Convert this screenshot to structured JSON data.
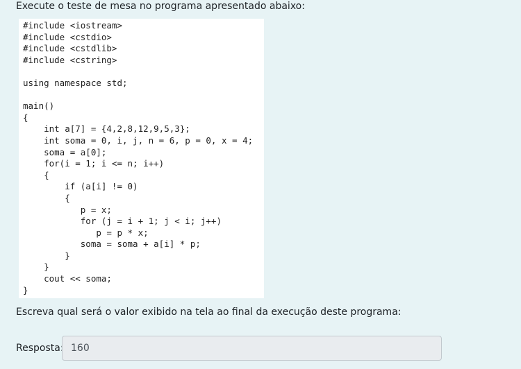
{
  "question": {
    "prompt": "Execute o teste de mesa no programa apresentado abaixo:",
    "code": "#include <iostream>\n#include <cstdio>\n#include <cstdlib>\n#include <cstring>\n\nusing namespace std;\n\nmain()\n{\n    int a[7] = {4,2,8,12,9,5,3};\n    int soma = 0, i, j, n = 6, p = 0, x = 4;\n    soma = a[0];\n    for(i = 1; i <= n; i++)\n    {\n        if (a[i] != 0)\n        {\n           p = x;\n           for (j = i + 1; j < i; j++)\n              p = p * x;\n           soma = soma + a[i] * p;\n        }\n    }\n    cout << soma;\n}",
    "instruction": "Escreva qual será o valor exibido na tela ao final da execução deste programa:"
  },
  "answer": {
    "label": "Resposta:",
    "value": "160"
  }
}
